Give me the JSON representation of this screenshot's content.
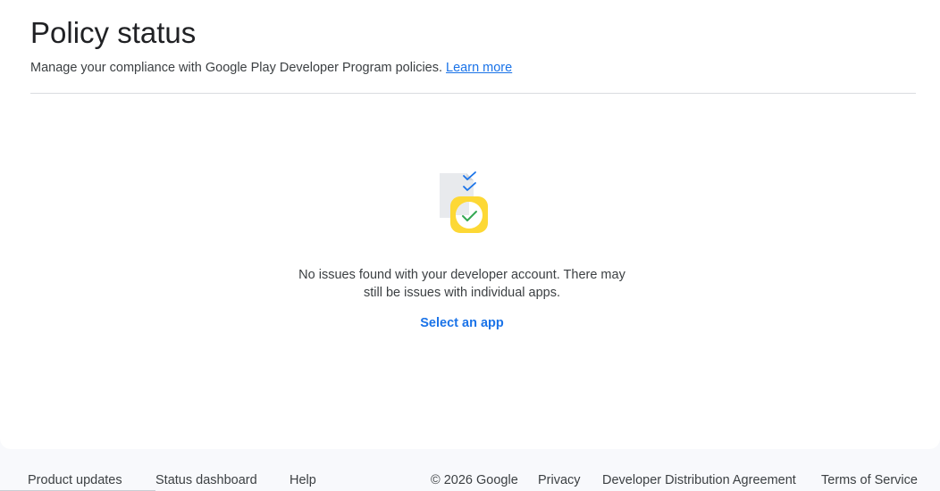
{
  "header": {
    "title": "Policy status",
    "subtitle": "Manage your compliance with Google Play Developer Program policies.",
    "learn_more": "Learn more"
  },
  "empty_state": {
    "illustration_icon": "document-checklist-icon",
    "message": "No issues found with your developer account. There may still be issues with individual apps.",
    "action_label": "Select an app"
  },
  "footer": {
    "left_links": [
      "Product updates",
      "Status dashboard",
      "Help"
    ],
    "copyright": "© 2026 Google",
    "right_links": [
      "Privacy",
      "Developer Distribution Agreement",
      "Terms of Service"
    ]
  },
  "colors": {
    "accent": "#1a73e8",
    "badge_yellow": "#fdd835",
    "check_green": "#34a853",
    "doc_gray": "#e8eaed"
  }
}
